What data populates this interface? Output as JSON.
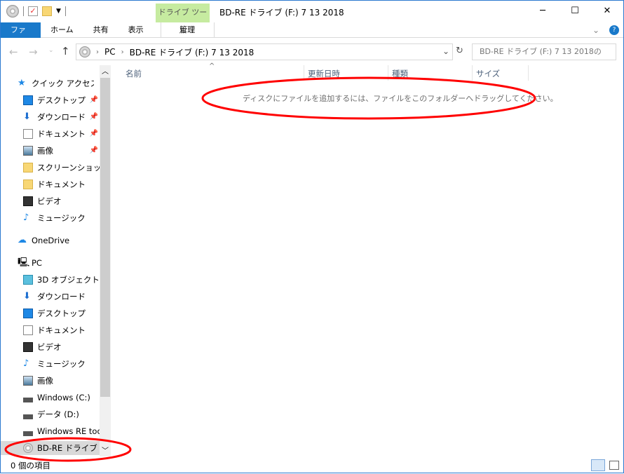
{
  "title": {
    "context_tab": "ドライブ ツール",
    "window_title": "BD-RE ドライブ (F:) 7 13 2018",
    "minimize": "─",
    "maximize": "☐",
    "close": "✕"
  },
  "ribbon": {
    "tabs": [
      "ファイル",
      "ホーム",
      "共有",
      "表示"
    ],
    "manage": "管理"
  },
  "address": {
    "parts": [
      "PC",
      "BD-RE ドライブ (F:) 7 13 2018"
    ],
    "search_placeholder": "BD-RE ドライブ (F:) 7 13 2018の"
  },
  "nav": {
    "quick_access": "クイック アクセス",
    "quick_items": [
      {
        "label": "デスクトップ",
        "icon": "desktop-icon",
        "pinned": true
      },
      {
        "label": "ダウンロード",
        "icon": "download-icon",
        "pinned": true
      },
      {
        "label": "ドキュメント",
        "icon": "document-icon",
        "pinned": true
      },
      {
        "label": "画像",
        "icon": "picture-icon",
        "pinned": true
      },
      {
        "label": "スクリーンショット",
        "icon": "folder-icon"
      },
      {
        "label": "ドキュメント",
        "icon": "folder-icon"
      },
      {
        "label": "ビデオ",
        "icon": "video-icon"
      },
      {
        "label": "ミュージック",
        "icon": "music-icon"
      }
    ],
    "onedrive": "OneDrive",
    "pc": "PC",
    "pc_items": [
      {
        "label": "3D オブジェクト",
        "icon": "3d-objects-icon"
      },
      {
        "label": "ダウンロード",
        "icon": "download-icon"
      },
      {
        "label": "デスクトップ",
        "icon": "desktop-icon"
      },
      {
        "label": "ドキュメント",
        "icon": "document-icon"
      },
      {
        "label": "ビデオ",
        "icon": "video-icon"
      },
      {
        "label": "ミュージック",
        "icon": "music-icon"
      },
      {
        "label": "画像",
        "icon": "picture-icon"
      },
      {
        "label": "Windows (C:)",
        "icon": "drive-icon"
      },
      {
        "label": "データ (D:)",
        "icon": "drive-icon"
      },
      {
        "label": "Windows RE too",
        "icon": "drive-icon"
      },
      {
        "label": "BD-RE ドライブ (F:",
        "icon": "cd-drive-icon",
        "selected": true
      }
    ]
  },
  "columns": [
    "名前",
    "更新日時",
    "種類",
    "サイズ"
  ],
  "empty_message": "ディスクにファイルを追加するには、ファイルをこのフォルダーへドラッグしてください。",
  "status": "0 個の項目",
  "colors": {
    "accent": "#1979ca",
    "context_tab": "#c6eba0",
    "annotation": "#ff0000"
  }
}
